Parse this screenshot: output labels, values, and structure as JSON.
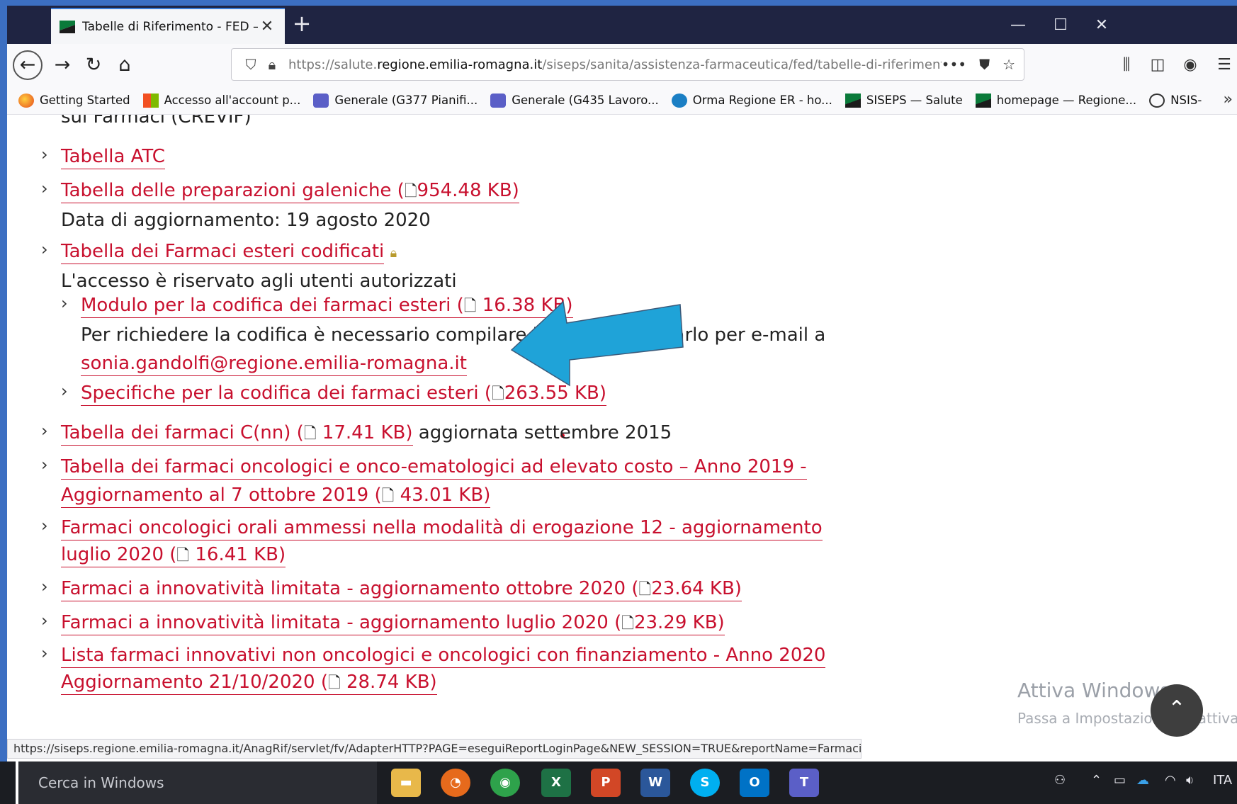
{
  "browser": {
    "tab_title": "Tabelle di Riferimento - FED —",
    "url_scheme": "https://salute.",
    "url_host": "regione.emilia-romagna.it",
    "url_path": "/siseps/sanita/assistenza-farmaceutica/fed/tabelle-di-riferimento",
    "url_more": "•••"
  },
  "bookmarks": [
    {
      "label": "Getting Started",
      "icon": "firefox-icon"
    },
    {
      "label": "Accesso all'account p...",
      "icon": "microsoft-icon"
    },
    {
      "label": "Generale (G377 Pianifi...",
      "icon": "teams-icon"
    },
    {
      "label": "Generale (G435 Lavoro...",
      "icon": "teams-icon"
    },
    {
      "label": "Orma Regione ER - ho...",
      "icon": "sharepoint-icon"
    },
    {
      "label": "SISEPS — Salute",
      "icon": "region-flag-icon"
    },
    {
      "label": "homepage — Regione...",
      "icon": "region-flag-icon"
    },
    {
      "label": "NSIS-",
      "icon": "globe-icon"
    }
  ],
  "content": {
    "cut_top": "sui Farmaci (CREVIF)",
    "tabella_atc": "Tabella ATC",
    "galeniche_link": "Tabella delle preparazioni galeniche (",
    "galeniche_size": "954.48 KB)",
    "galeniche_date": "Data di aggiornamento: 19 agosto 2020",
    "esteri_link": "Tabella dei Farmaci esteri codificati",
    "esteri_note": "L'accesso è riservato agli utenti autorizzati",
    "modulo_link": "Modulo per la codifica dei farmaci esteri (",
    "modulo_size": "16.38 KB)",
    "modulo_note": "Per richiedere la codifica è necessario compilare il modulo e inviarlo per e-mail a",
    "email": "sonia.gandolfi@regione.emilia-romagna.it",
    "specifiche_link": "Specifiche per la codifica dei farmaci esteri (",
    "specifiche_size": "263.55 KB)",
    "cnn_link": "Tabella dei farmaci C(nn) (",
    "cnn_size": "17.41 KB)",
    "cnn_note": "aggiornata settembre 2015",
    "onco_line1": "Tabella dei farmaci oncologici e onco-ematologici ad elevato costo – Anno 2019 -",
    "onco_line2": "Aggiornamento al 7 ottobre 2019 (",
    "onco_size": "43.01 KB)",
    "orali_line1": "Farmaci oncologici orali ammessi nella modalità di erogazione 12 - aggiornamento",
    "orali_line2": "luglio 2020 (",
    "orali_size": "16.41 KB)",
    "innov_ott": "Farmaci a innovatività limitata - aggiornamento ottobre 2020 (",
    "innov_ott_size": "23.64 KB)",
    "innov_lug": "Farmaci a innovatività limitata - aggiornamento luglio 2020 (",
    "innov_lug_size": "23.29 KB)",
    "lista_line1": "Lista farmaci innovativi non oncologici e oncologici con finanziamento - Anno 2020",
    "lista_line2_cut": "Aggiornamento 21/10/2020 (",
    "lista_size_cut": "28.74 KB)"
  },
  "overlay": {
    "watermark_title": "Attiva Windows",
    "watermark_sub": "Passa a Impostazioni per attivare"
  },
  "statusbar": {
    "url": "https://siseps.regione.emilia-romagna.it/AnagRif/servlet/fv/AdapterHTTP?PAGE=eseguiReportLoginPage&NEW_SESSION=TRUE&reportName=FarmaciEsteri"
  },
  "taskbar": {
    "search_placeholder": "Cerca in Windows",
    "language": "ITA"
  },
  "colors": {
    "link": "#c8102e",
    "arrow": "#1fa3d8",
    "titlebar": "#1f2442"
  }
}
